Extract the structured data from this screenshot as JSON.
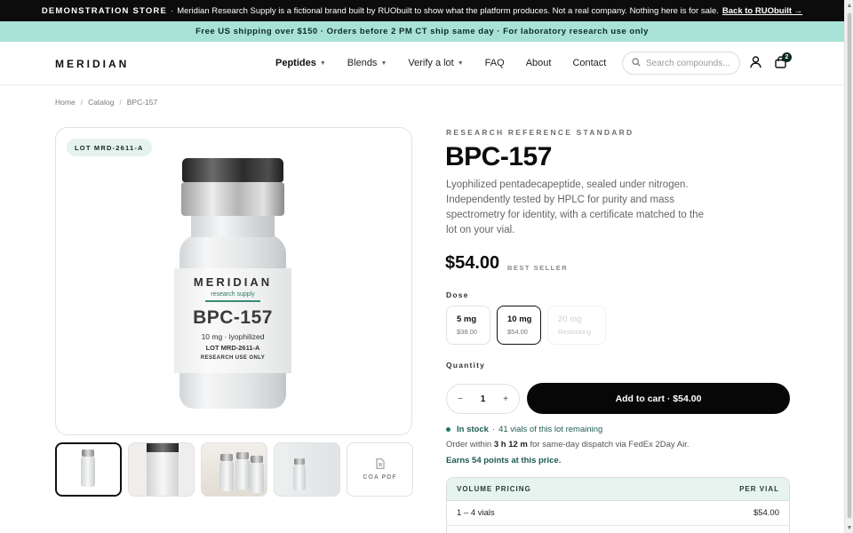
{
  "demo_bar": {
    "label": "DEMONSTRATION STORE",
    "sep": "·",
    "text": "Meridian Research Supply is a fictional brand built by RUObuilt to show what the platform produces. Not a real company. Nothing here is for sale.",
    "link": "Back to RUObuilt →"
  },
  "ship_bar": {
    "text": "Free US shipping over $150 · Orders before 2 PM CT ship same day · For laboratory research use only"
  },
  "header": {
    "logo": "MERIDIAN",
    "nav": [
      {
        "label": "Peptides",
        "dropdown": true
      },
      {
        "label": "Blends",
        "dropdown": true
      },
      {
        "label": "Verify a lot",
        "dropdown": true
      },
      {
        "label": "FAQ",
        "dropdown": false
      },
      {
        "label": "About",
        "dropdown": false
      },
      {
        "label": "Contact",
        "dropdown": false
      }
    ],
    "search_placeholder": "Search compounds...",
    "cart_count": "2",
    "icons": [
      "search-icon",
      "user-icon",
      "cart-icon"
    ]
  },
  "breadcrumb": [
    "Home",
    "Catalog",
    "BPC-157"
  ],
  "gallery": {
    "lot_pill": "LOT MRD-2611-A",
    "vial_label": {
      "brand": "MERIDIAN",
      "sub": "research supply",
      "name": "BPC-157",
      "dose": "10 mg · lyophilized",
      "lot": "LOT MRD-2611-A",
      "ruo": "RESEARCH USE ONLY"
    },
    "coa_label": "COA PDF"
  },
  "product": {
    "eyebrow": "RESEARCH REFERENCE STANDARD",
    "title": "BPC-157",
    "description": "Lyophilized pentadecapeptide, sealed under nitrogen. Independently tested by HPLC for purity and mass spectrometry for identity, with a certificate matched to the lot on your vial.",
    "price": "$54.00",
    "badge": "BEST SELLER",
    "dose_label": "Dose",
    "doses": [
      {
        "weight": "5 mg",
        "price": "$38.00",
        "state": "available"
      },
      {
        "weight": "10 mg",
        "price": "$54.00",
        "state": "selected"
      },
      {
        "weight": "20 mg",
        "price": "Restocking",
        "state": "disabled"
      }
    ],
    "quantity_label": "Quantity",
    "quantity": "1",
    "minus": "−",
    "plus": "+",
    "add_to_cart": "Add to cart · $54.00"
  },
  "stock": {
    "status": "In stock",
    "sep": "·",
    "remaining": "41 vials of this lot remaining",
    "dispatch_pre": "Order within",
    "dispatch_time": "3 h 12 m",
    "dispatch_post": "for same-day dispatch via FedEx 2Day Air.",
    "points": "Earns 54 points at this price."
  },
  "volume_pricing": {
    "header_left": "VOLUME PRICING",
    "header_right": "PER VIAL",
    "rows": [
      {
        "range": "1 – 4 vials",
        "price": "$54.00"
      }
    ]
  },
  "colors": {
    "accent_mint": "#a8e2d6",
    "dark": "#070707",
    "green_text": "#1f5e52"
  }
}
